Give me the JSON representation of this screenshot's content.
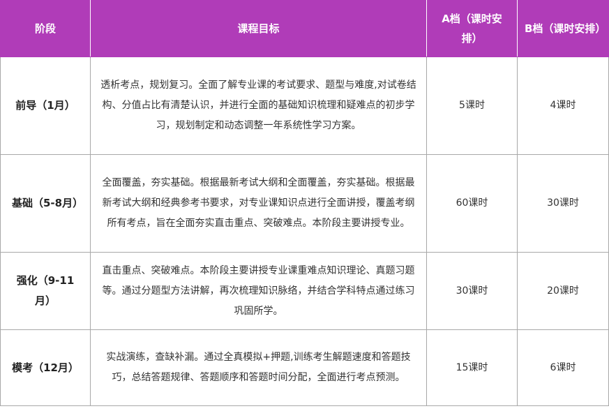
{
  "header": {
    "stage": "阶段",
    "goal": "课程目标",
    "a_hours": "A档（课时安排）",
    "b_hours": "B档（课时安排）"
  },
  "rows": [
    {
      "stage": "前导（1月）",
      "goal": "透析考点，规划复习。全面了解专业课的考试要求、题型与难度,对试卷结构、分值占比有清楚认识，并进行全面的基础知识梳理和疑难点的初步学习，规划制定和动态调整一年系统性学习方案。",
      "a": "5课时",
      "b": "4课时"
    },
    {
      "stage": "基础（5-8月）",
      "goal": "全面覆盖，夯实基础。根据最新考试大纲和全面覆盖，夯实基础。根据最新考试大纲和经典参考书要求，对专业课知识点进行全面讲授，覆盖考纲所有考点，旨在全面夯实直击重点、突破难点。本阶段主要讲授专业。",
      "a": "60课时",
      "b": "30课时"
    },
    {
      "stage": "强化（9-11月）",
      "goal": "直击重点、突破难点。本阶段主要讲授专业课重难点知识理论、真题习题等。通过分题型方法讲解，再次梳理知识脉络，并结合学科特点通过练习巩固所学。",
      "a": "30课时",
      "b": "20课时"
    },
    {
      "stage": "模考（12月）",
      "goal": "实战演练，查缺补漏。通过全真模拟+押题,训练考生解题速度和答题技巧，总结答题规律、答题顺序和答题时间分配，全面进行考点预测。",
      "a": "15课时",
      "b": "6课时"
    }
  ]
}
